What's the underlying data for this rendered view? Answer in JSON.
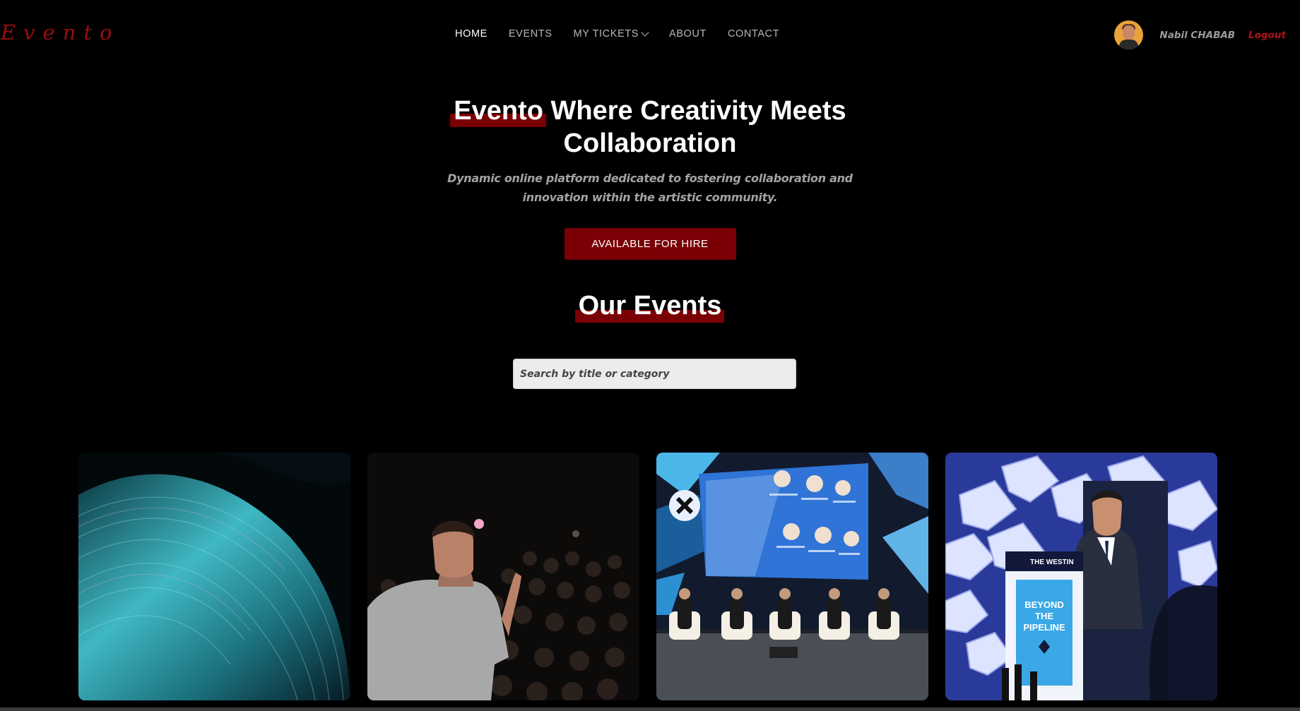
{
  "brand": {
    "logo": "Evento"
  },
  "nav": {
    "items": [
      {
        "label": "HOME",
        "active": true
      },
      {
        "label": "EVENTS",
        "active": false
      },
      {
        "label": "MY TICKETS",
        "active": false,
        "has_dropdown": true
      },
      {
        "label": "ABOUT",
        "active": false
      },
      {
        "label": "CONTACT",
        "active": false
      }
    ]
  },
  "user": {
    "name": "Nabil CHABAB",
    "logout_label": "Logout"
  },
  "hero": {
    "title_highlight": "Evento",
    "title_rest_line1": "Where Creativity Meets",
    "title_line2": "Collaboration",
    "subtitle": "Dynamic online platform dedicated to fostering collaboration and innovation within the artistic community.",
    "cta_label": "AVAILABLE FOR HIRE"
  },
  "events_section": {
    "title": "Our Events",
    "search_placeholder": "Search by title or category"
  },
  "event_cards": [
    {
      "image": "abstract-wave-teal"
    },
    {
      "image": "speaker-audience"
    },
    {
      "image": "panel-conference"
    },
    {
      "image": "keynote-podium"
    }
  ],
  "colors": {
    "accent": "#7a0006",
    "logo": "#9b0d0d",
    "logout": "#b2121b",
    "background": "#000000"
  }
}
